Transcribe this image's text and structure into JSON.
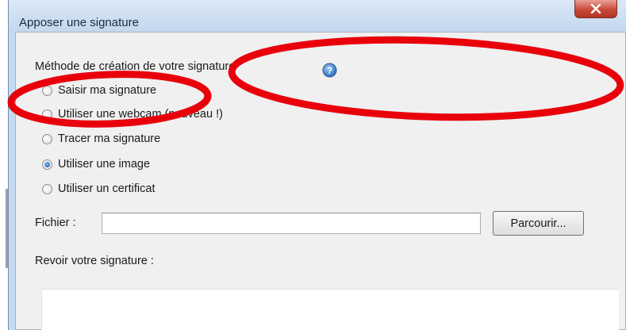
{
  "window": {
    "title": "Apposer une signature",
    "close_glyph": "x"
  },
  "method": {
    "label": "Méthode de création de votre signature",
    "help_icon": "question-mark-circle-icon",
    "options": [
      {
        "label": "Saisir ma signature",
        "checked": false
      },
      {
        "label": "Utiliser une webcam (nouveau !)",
        "checked": false
      },
      {
        "label": "Tracer ma signature",
        "checked": false
      },
      {
        "label": "Utiliser une image",
        "checked": true
      },
      {
        "label": "Utiliser un certificat",
        "checked": false
      }
    ]
  },
  "file": {
    "label": "Fichier :",
    "value": "",
    "browse_label": "Parcourir..."
  },
  "review": {
    "label": "Revoir votre signature :"
  },
  "colors": {
    "annotation": "#e8000b",
    "close_button": "#c9483a",
    "radio_selected": "#1c57a8"
  }
}
